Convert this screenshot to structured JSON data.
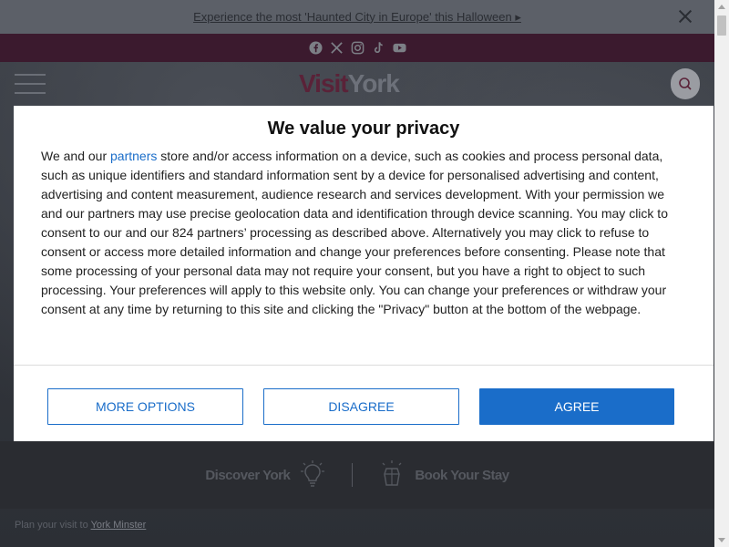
{
  "announcement": {
    "link_text": "Experience the most 'Haunted City in Europe' this Halloween ▸"
  },
  "social": {
    "icons": [
      "facebook-icon",
      "x-icon",
      "instagram-icon",
      "tiktok-icon",
      "youtube-icon"
    ]
  },
  "header": {
    "logo_visit": "Visit",
    "logo_york": "York"
  },
  "hero": {
    "discover_label": "Discover York",
    "book_label": "Book Your Stay",
    "breadcrumb_prefix": "Plan your visit to",
    "breadcrumb_link": "York Minster"
  },
  "consent": {
    "title": "We value your privacy",
    "body_before_link": "We and our ",
    "partners_link": "partners",
    "body_after_link": " store and/or access information on a device, such as cookies and process personal data, such as unique identifiers and standard information sent by a device for personalised advertising and content, advertising and content measurement, audience research and services development. With your permission we and our partners may use precise geolocation data and identification through device scanning. You may click to consent to our and our 824 partners’ processing as described above. Alternatively you may click to refuse to consent or access more detailed information and change your preferences before consenting. Please note that some processing of your personal data may not require your consent, but you have a right to object to such processing. Your preferences will apply to this website only. You can change your preferences or withdraw your consent at any time by returning to this site and clicking the \"Privacy\" button at the bottom of the webpage.",
    "more_options": "MORE OPTIONS",
    "disagree": "DISAGREE",
    "agree": "AGREE"
  },
  "colors": {
    "accent": "#1a6dc9",
    "brand": "#5a2238",
    "overlay": "#3a3d44"
  }
}
